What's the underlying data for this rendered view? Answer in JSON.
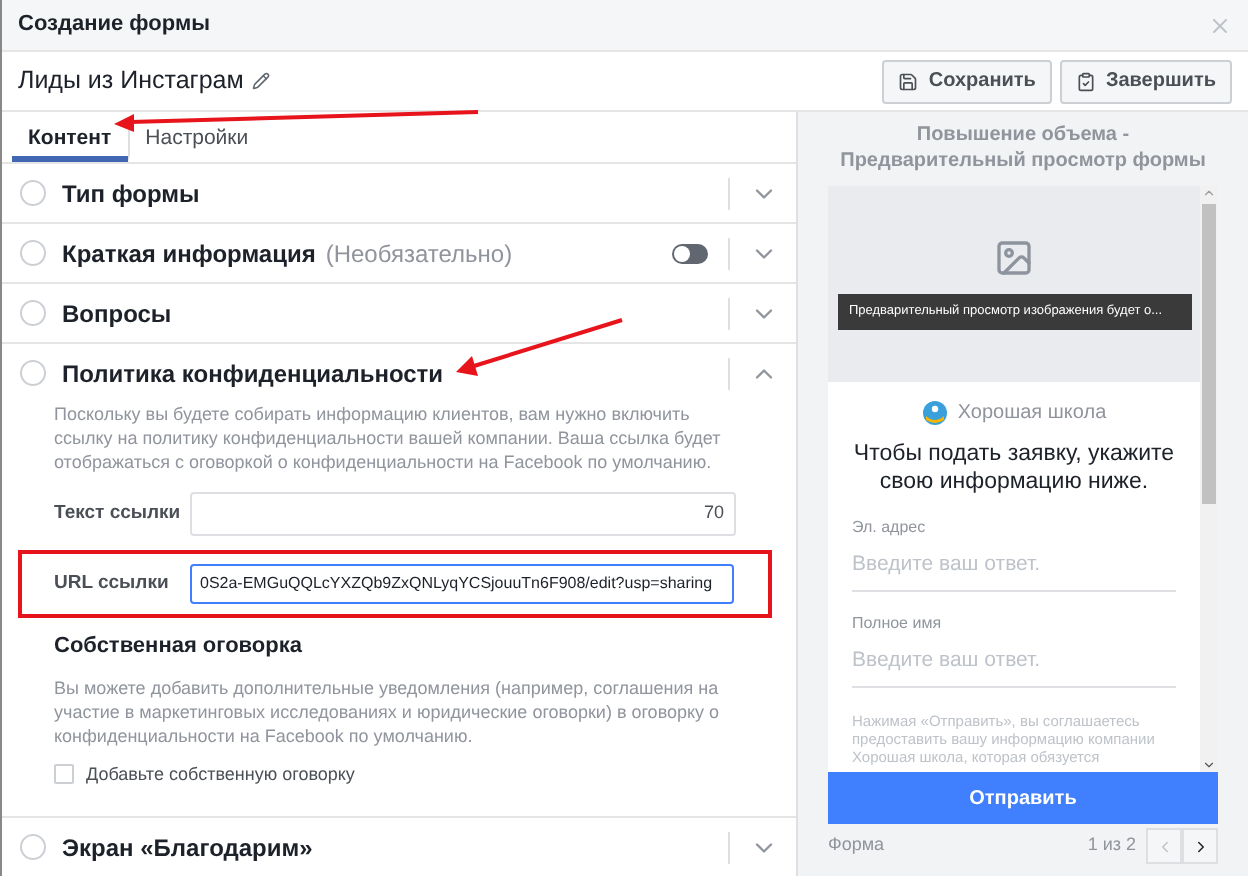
{
  "dialog": {
    "title": "Создание формы"
  },
  "form_name": "Лиды из Инстаграм",
  "actions": [
    {
      "label": "Сохранить",
      "kind": "save"
    },
    {
      "label": "Завершить",
      "kind": "finish"
    }
  ],
  "tabs": [
    {
      "label": "Контент",
      "selected": true
    },
    {
      "label": "Настройки",
      "selected": false
    }
  ],
  "sections": [
    {
      "title": "Тип формы",
      "expanded": false
    },
    {
      "title": "Краткая информация",
      "optional": "(Необязательно)",
      "toggle_on": false,
      "expanded": false
    },
    {
      "title": "Вопросы",
      "expanded": false
    },
    {
      "title": "Политика конфиденциальности",
      "expanded": true,
      "description": "Поскольку вы будете собирать информацию клиентов, вам нужно включить ссылку на политику конфиденциальности вашей компании. Ваша ссылка будет отображаться с оговоркой о конфиденциальности на Facebook по умолчанию.",
      "fields": [
        {
          "label": "Текст ссылки",
          "counter": "70",
          "highlighted": false
        },
        {
          "label": "URL ссылки",
          "value": "0S2a-EMGuQQLcYXZQb9ZxQNLyqYCSjouuTn6F908/edit?usp=sharing",
          "highlighted": true
        }
      ],
      "subsection": {
        "title": "Собственная оговорка",
        "description": "Вы можете добавить дополнительные уведомления (например, соглашения на участие в маркетинговых исследованиях и юридические оговорки) в оговорку о конфиденциальности на Facebook по умолчанию.",
        "checkbox": {
          "label": "Добавьте собственную оговорку",
          "checked": false
        }
      }
    },
    {
      "title": "Экран «Благодарим»",
      "expanded": false
    }
  ],
  "preview": {
    "title": "Повышение объема - Предварительный просмотр формы",
    "image_caption": "Предварительный просмотр изображения будет о...",
    "company": "Хорошая школа",
    "heading": "Чтобы подать заявку, укажите свою информацию ниже.",
    "fields": [
      {
        "label": "Эл. адрес",
        "placeholder": "Введите ваш ответ."
      },
      {
        "label": "Полное имя",
        "placeholder": "Введите ваш ответ."
      }
    ],
    "disclaimer": "Нажимая «Отправить», вы соглашаетесь предоставить вашу информацию компании Хорошая школа, которая обязуется",
    "submit": "Отправить",
    "footer_label": "Форма",
    "page": "1 из 2"
  }
}
